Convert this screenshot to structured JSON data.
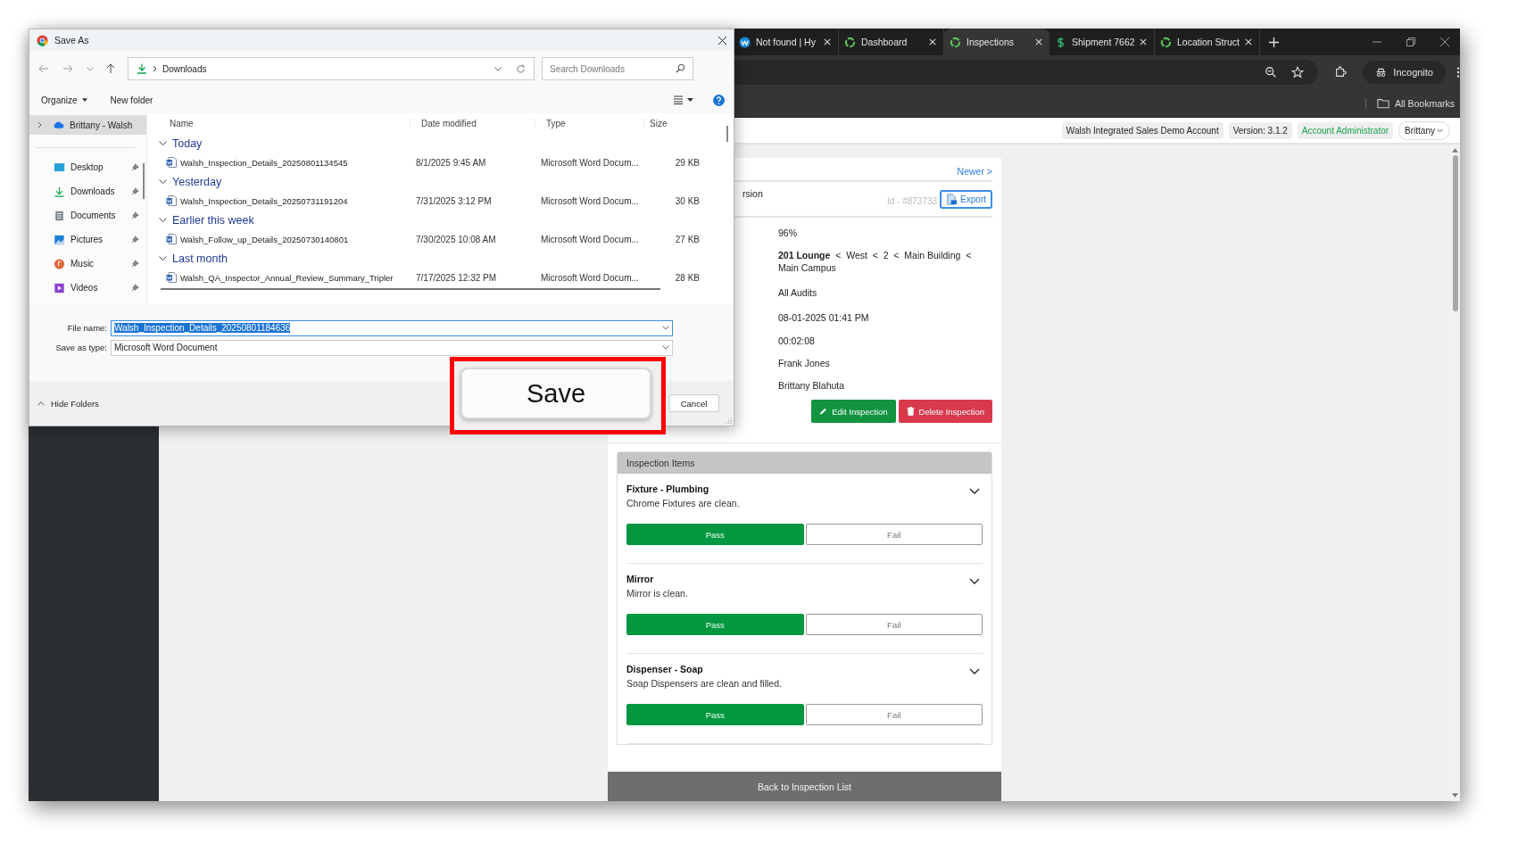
{
  "browser": {
    "tabs": [
      {
        "title": "Not found | Hy",
        "selected": false
      },
      {
        "title": "Dashboard",
        "selected": false
      },
      {
        "title": "Inspections",
        "selected": true
      },
      {
        "title": "Shipment 7662",
        "selected": false
      },
      {
        "title": "Location Struct",
        "selected": false
      }
    ],
    "profile": "Incognito",
    "bookmarks_label": "All Bookmarks"
  },
  "app_header": {
    "account": "Walsh Integrated Sales Demo Account",
    "version": "Version: 3.1.2",
    "role": "Account Administrator",
    "user": "Brittany"
  },
  "inspection": {
    "newer_link": "Newer >",
    "title_fragment": "rsion",
    "id": "Id - #873733",
    "export": "Export",
    "details": [
      "96%",
      "**201 Lounge**  <  West  <  2  <  Main Building  <  Main Campus",
      "All Audits",
      "08-01-2025 01:41 PM",
      "00:02:08",
      "Frank Jones",
      "Brittany Blahuta"
    ],
    "actions": [
      {
        "label": "Edit Inspection",
        "kind": "edit"
      },
      {
        "label": "Delete Inspection",
        "kind": "delete"
      }
    ]
  },
  "inspection_items": {
    "title": "Inspection Items",
    "items": [
      {
        "name": "Fixture - Plumbing",
        "description": "Chrome Fixtures are clean.",
        "options": [
          {
            "label": "Pass",
            "selected": true
          },
          {
            "label": "Fail",
            "selected": false
          }
        ]
      },
      {
        "name": "Mirror",
        "description": "Mirror is clean.",
        "options": [
          {
            "label": "Pass",
            "selected": true
          },
          {
            "label": "Fail",
            "selected": false
          }
        ]
      },
      {
        "name": "Dispenser - Soap",
        "description": "Soap Dispensers are clean and filled.",
        "options": [
          {
            "label": "Pass",
            "selected": true
          },
          {
            "label": "Fail",
            "selected": false
          }
        ]
      }
    ]
  },
  "footer_button": "Back to Inspection List",
  "dialog": {
    "title": "Save As",
    "location": "Downloads",
    "search_placeholder": "Search Downloads",
    "organize": "Organize",
    "new_folder": "New folder",
    "nav_items": [
      {
        "label": "Brittany - Walsh",
        "selected": true
      },
      {
        "label": "Desktop",
        "selected": false
      },
      {
        "label": "Downloads",
        "selected": false
      },
      {
        "label": "Documents",
        "selected": false
      },
      {
        "label": "Pictures",
        "selected": false
      },
      {
        "label": "Music",
        "selected": false
      },
      {
        "label": "Videos",
        "selected": false
      }
    ],
    "columns": [
      "Name",
      "Date modified",
      "Type",
      "Size"
    ],
    "groups": [
      {
        "label": "Today",
        "files": [
          {
            "name": "Walsh_Inspection_Details_20250801134545",
            "date": "8/1/2025 9:45 AM",
            "type": "Microsoft Word Docum...",
            "size": "29 KB"
          }
        ]
      },
      {
        "label": "Yesterday",
        "files": [
          {
            "name": "Walsh_Inspection_Details_20250731191204",
            "date": "7/31/2025 3:12 PM",
            "type": "Microsoft Word Docum...",
            "size": "30 KB"
          }
        ]
      },
      {
        "label": "Earlier this week",
        "files": [
          {
            "name": "Walsh_Follow_up_Details_20250730140801",
            "date": "7/30/2025 10:08 AM",
            "type": "Microsoft Word Docum...",
            "size": "27 KB"
          }
        ]
      },
      {
        "label": "Last month",
        "files": [
          {
            "name": "Walsh_QA_Inspector_Annual_Review_Summary_Tripler",
            "date": "7/17/2025 12:32 PM",
            "type": "Microsoft Word Docum...",
            "size": "28 KB"
          }
        ]
      }
    ],
    "file_name_label": "File name:",
    "file_name": "Walsh_Inspection_Details_20250801184636",
    "type_label": "Save as type:",
    "save_type": "Microsoft Word Document",
    "hide_folders": "Hide Folders",
    "cancel": "Cancel"
  },
  "callout": {
    "button": "Save"
  }
}
